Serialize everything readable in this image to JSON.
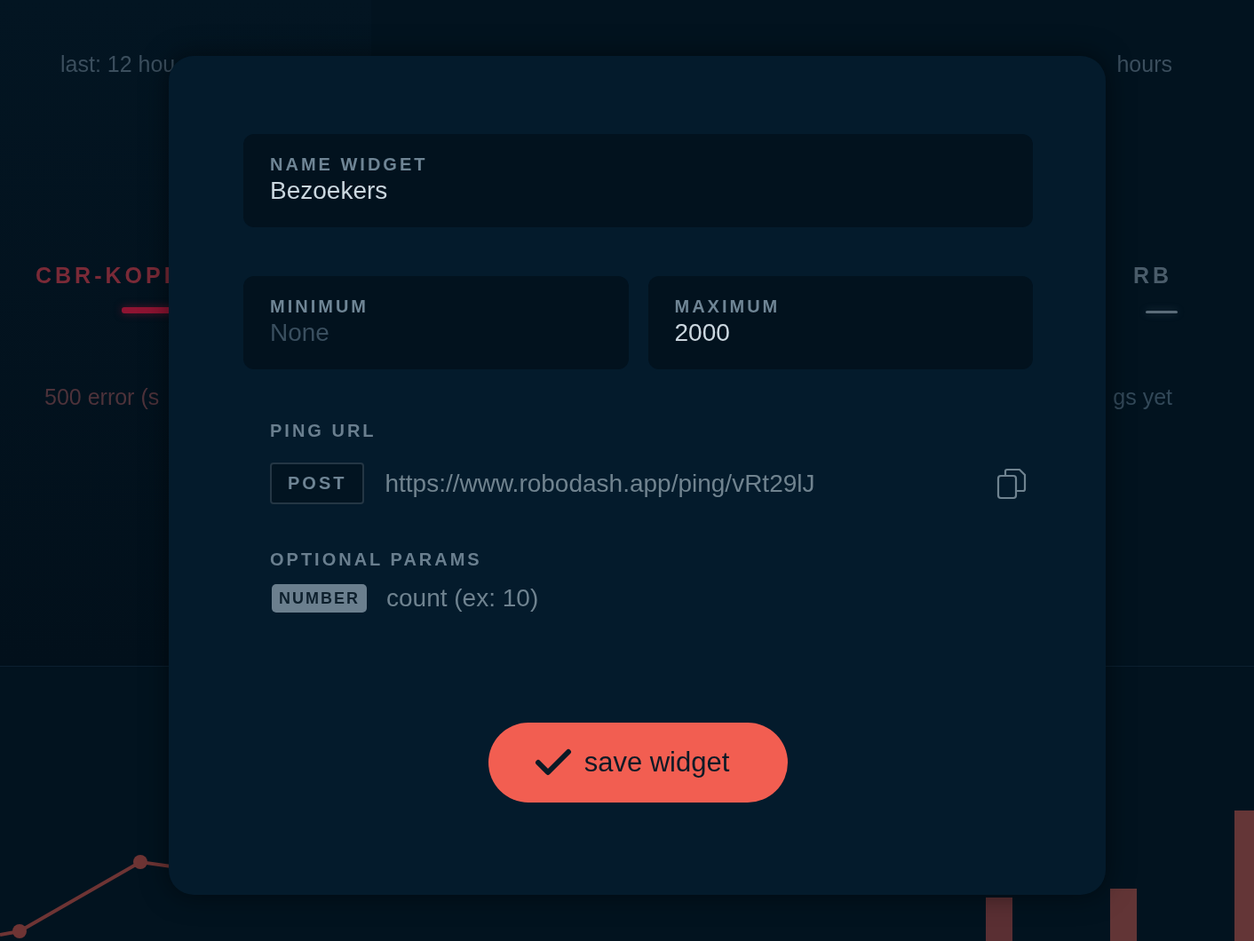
{
  "background": {
    "cards": [
      {
        "kind": "error",
        "subtitle": "last: 12 hou",
        "title": "CBR-KOPI",
        "message": "500 error (s"
      },
      {
        "kind": "idle",
        "subtitle": "hours",
        "title": "RB",
        "message": "gs yet"
      }
    ]
  },
  "modal": {
    "name_field": {
      "label": "NAME WIDGET",
      "value": "Bezoekers"
    },
    "range_fields": [
      {
        "label": "MINIMUM",
        "placeholder": "None"
      },
      {
        "label": "MAXIMUM",
        "value": "2000"
      }
    ],
    "ping_url": {
      "label": "PING URL",
      "method": "POST",
      "url": "https://www.robodash.app/ping/vRt29lJ"
    },
    "optional_params": {
      "label": "OPTIONAL PARAMS",
      "params": [
        {
          "type": "NUMBER",
          "name": "count (ex: 10)"
        }
      ]
    },
    "save_button": {
      "label": "save widget"
    }
  }
}
